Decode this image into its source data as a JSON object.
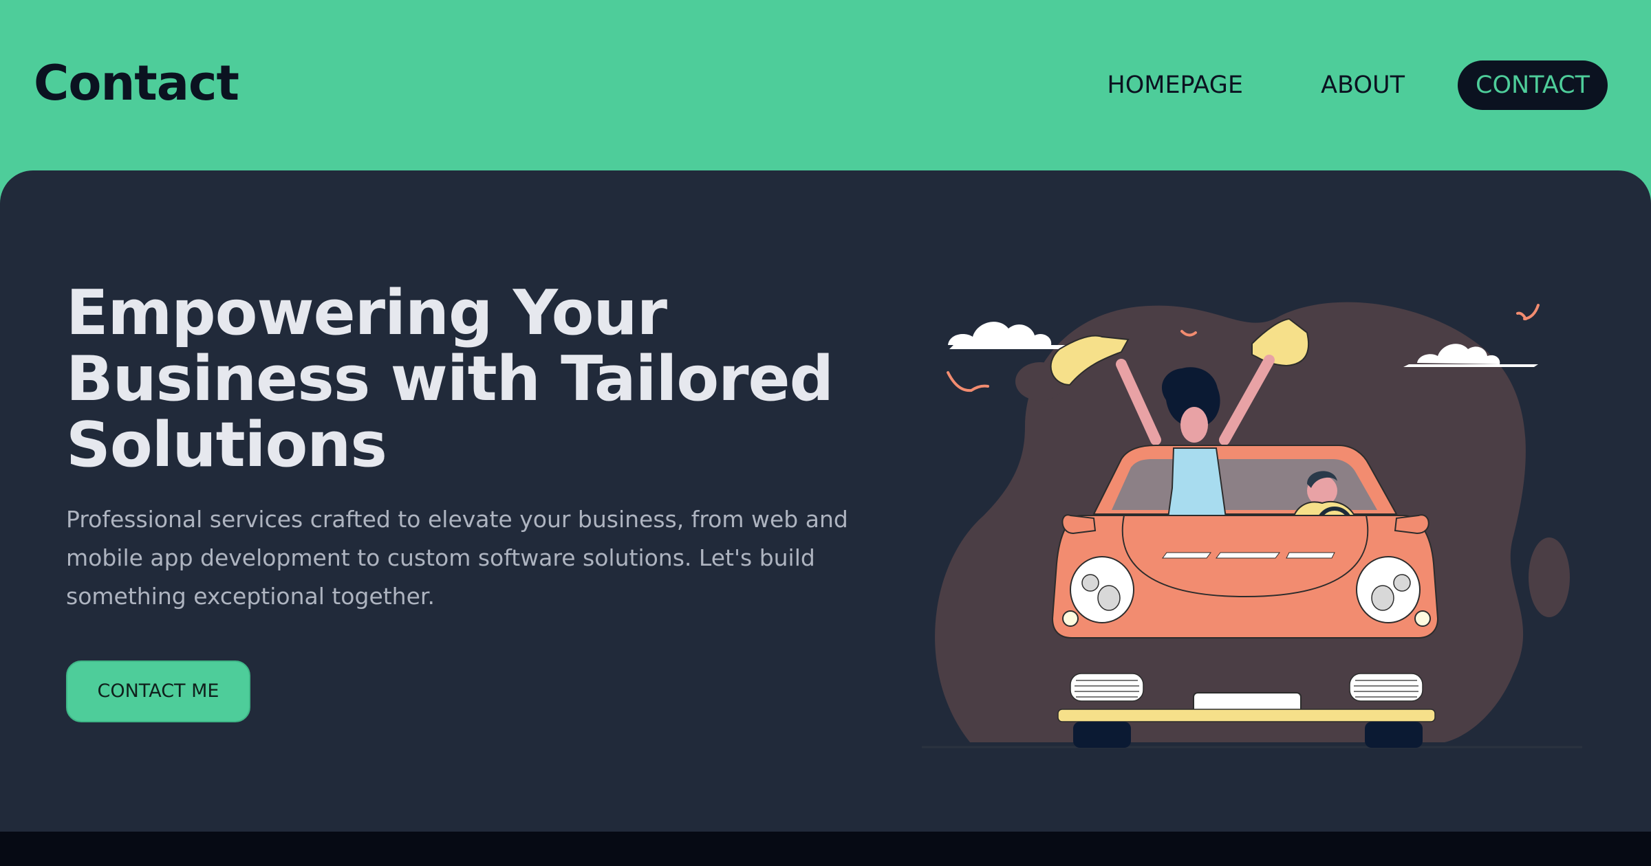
{
  "header": {
    "brand": "Contact",
    "nav": [
      {
        "label": "HOMEPAGE",
        "active": false
      },
      {
        "label": "ABOUT",
        "active": false
      },
      {
        "label": "CONTACT",
        "active": true
      }
    ]
  },
  "hero": {
    "title_lines": [
      "Empowering Your",
      "Business with Tailored",
      "Solutions"
    ],
    "description_lines": [
      "Professional services crafted to elevate your business, from web and",
      "mobile app development to custom software solutions. Let's build",
      "something exceptional together."
    ],
    "cta_label": "CONTACT ME"
  },
  "colors": {
    "accent": "#4ecd9a",
    "hero_bg": "#212a3a",
    "dark": "#0b1220",
    "car": "#f28c70",
    "blob": "#4b3e45"
  },
  "icons": [
    "illustration-car-couple",
    "cloud-icon",
    "bird-icon"
  ]
}
